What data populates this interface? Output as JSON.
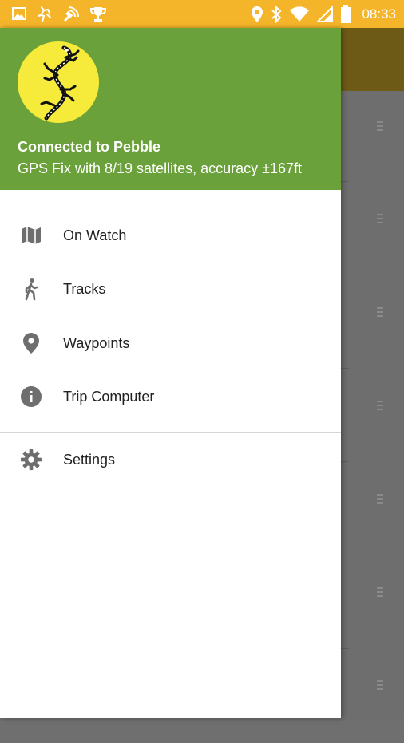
{
  "status_bar": {
    "time": "08:33",
    "left_icons": [
      "image-icon",
      "app-activity-icon",
      "signal-tracking-icon",
      "trophy-icon"
    ],
    "right_icons": [
      "location-icon",
      "bluetooth-icon",
      "wifi-icon",
      "cellular-icon",
      "battery-icon"
    ],
    "color": "#f5b52a"
  },
  "drawer": {
    "header_color": "#6aa13b",
    "logo_icon": "lizard-logo-icon",
    "connection_status": "Connected to Pebble",
    "gps_status": "GPS Fix with 8/19 satellites, accuracy ±167ft",
    "items": [
      {
        "label": "On Watch",
        "icon": "map-icon"
      },
      {
        "label": "Tracks",
        "icon": "hiker-icon"
      },
      {
        "label": "Waypoints",
        "icon": "location-pin-icon"
      },
      {
        "label": "Trip Computer",
        "icon": "info-icon"
      }
    ],
    "settings": {
      "label": "Settings",
      "icon": "gear-icon"
    }
  }
}
